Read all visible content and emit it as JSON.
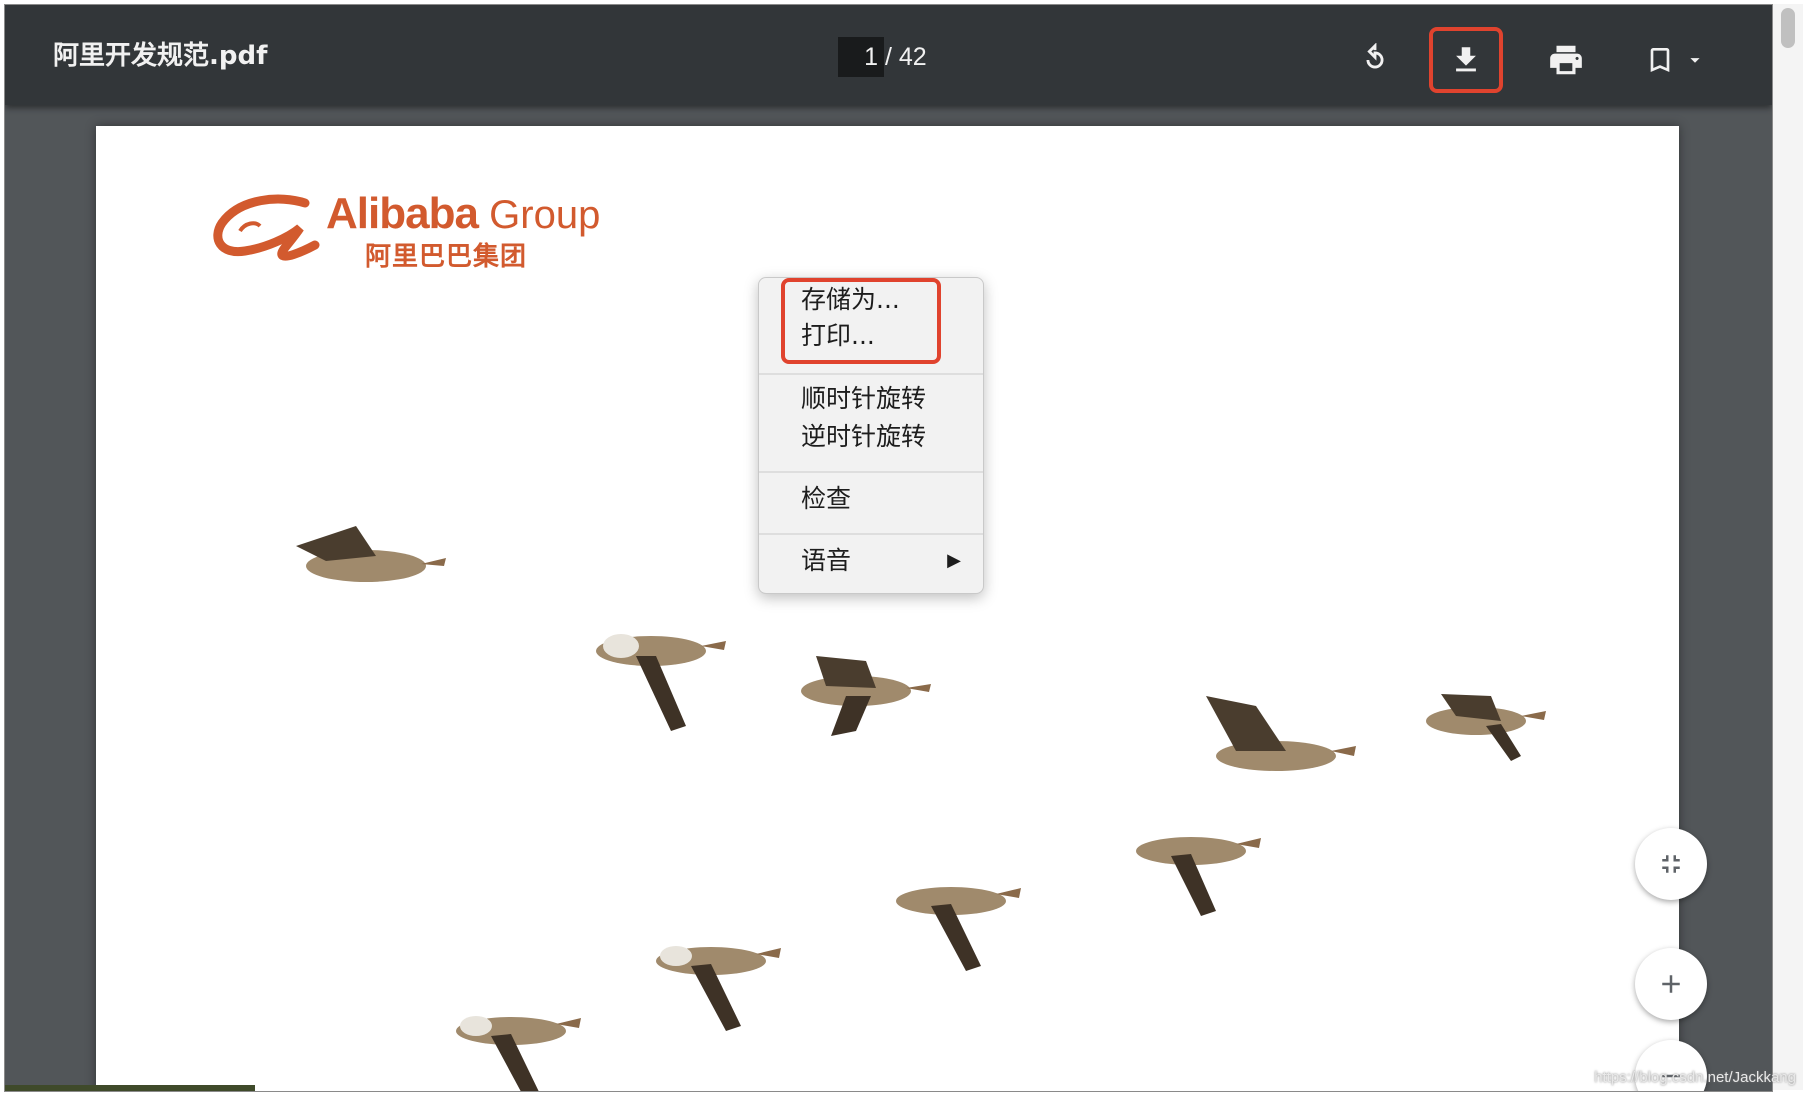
{
  "toolbar": {
    "title": "阿里开发规范.pdf",
    "page_current": "1",
    "page_total": "/ 42",
    "icons": [
      "rotate-icon",
      "download-icon",
      "print-icon",
      "bookmark-icon",
      "dropdown-caret-icon"
    ]
  },
  "document": {
    "logo_text": "Alibaba",
    "logo_group": "Group",
    "logo_cn": "阿里巴巴集团"
  },
  "context_menu": {
    "items": [
      {
        "label": "存储为..."
      },
      {
        "label": "打印..."
      },
      {
        "label": "顺时针旋转"
      },
      {
        "label": "逆时针旋转"
      },
      {
        "label": "检查"
      },
      {
        "label": "语音"
      }
    ],
    "submenu_arrow": "▶"
  },
  "controls": {
    "icons": [
      "fit-page-icon",
      "zoom-in-icon",
      "zoom-out-icon"
    ]
  },
  "watermark": "https://blog.csdn.net/Jackkang",
  "colors": {
    "toolbar_bg": "#323639",
    "viewer_bg": "#525659",
    "highlight": "#e0432e",
    "brand": "#d25a2e"
  }
}
